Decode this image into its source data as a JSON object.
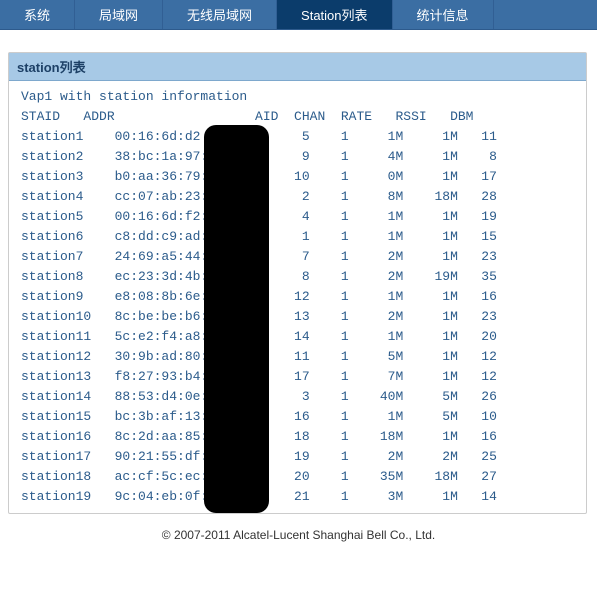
{
  "nav": {
    "items": [
      {
        "label": "系统",
        "active": false
      },
      {
        "label": "局域网",
        "active": false
      },
      {
        "label": "无线局域网",
        "active": false
      },
      {
        "label": "Station列表",
        "active": true
      },
      {
        "label": "统计信息",
        "active": false
      }
    ]
  },
  "panel": {
    "title": "station列表"
  },
  "term": {
    "header": "Vap1 with station information",
    "columns": "STAID   ADDR                  AID  CHAN  RATE   RSSI   DBM",
    "rows": [
      {
        "staid": "station1",
        "addr": "00:16:6d:d2",
        "aid": "5",
        "chan": "1",
        "rate": "1M",
        "rssi": "1M",
        "dbm": "11"
      },
      {
        "staid": "station2",
        "addr": "38:bc:1a:97:",
        "aid": "9",
        "chan": "1",
        "rate": "4M",
        "rssi": "1M",
        "dbm": "8"
      },
      {
        "staid": "station3",
        "addr": "b0:aa:36:79:",
        "aid": "10",
        "chan": "1",
        "rate": "0M",
        "rssi": "1M",
        "dbm": "17"
      },
      {
        "staid": "station4",
        "addr": "cc:07:ab:23:",
        "aid": "2",
        "chan": "1",
        "rate": "8M",
        "rssi": "18M",
        "dbm": "28"
      },
      {
        "staid": "station5",
        "addr": "00:16:6d:f2:",
        "aid": "4",
        "chan": "1",
        "rate": "1M",
        "rssi": "1M",
        "dbm": "19"
      },
      {
        "staid": "station6",
        "addr": "c8:dd:c9:ad:",
        "aid": "1",
        "chan": "1",
        "rate": "1M",
        "rssi": "1M",
        "dbm": "15"
      },
      {
        "staid": "station7",
        "addr": "24:69:a5:44:",
        "aid": "7",
        "chan": "1",
        "rate": "2M",
        "rssi": "1M",
        "dbm": "23"
      },
      {
        "staid": "station8",
        "addr": "ec:23:3d:4b:",
        "aid": "8",
        "chan": "1",
        "rate": "2M",
        "rssi": "19M",
        "dbm": "35"
      },
      {
        "staid": "station9",
        "addr": "e8:08:8b:6e:",
        "aid": "12",
        "chan": "1",
        "rate": "1M",
        "rssi": "1M",
        "dbm": "16"
      },
      {
        "staid": "station10",
        "addr": "8c:be:be:b6:",
        "aid": "13",
        "chan": "1",
        "rate": "2M",
        "rssi": "1M",
        "dbm": "23"
      },
      {
        "staid": "station11",
        "addr": "5c:e2:f4:a8:",
        "aid": "14",
        "chan": "1",
        "rate": "1M",
        "rssi": "1M",
        "dbm": "20"
      },
      {
        "staid": "station12",
        "addr": "30:9b:ad:80:",
        "aid": "11",
        "chan": "1",
        "rate": "5M",
        "rssi": "1M",
        "dbm": "12"
      },
      {
        "staid": "station13",
        "addr": "f8:27:93:b4:",
        "aid": "17",
        "chan": "1",
        "rate": "7M",
        "rssi": "1M",
        "dbm": "12"
      },
      {
        "staid": "station14",
        "addr": "88:53:d4:0e:",
        "aid": "3",
        "chan": "1",
        "rate": "40M",
        "rssi": "5M",
        "dbm": "26"
      },
      {
        "staid": "station15",
        "addr": "bc:3b:af:13:",
        "aid": "16",
        "chan": "1",
        "rate": "1M",
        "rssi": "5M",
        "dbm": "10"
      },
      {
        "staid": "station16",
        "addr": "8c:2d:aa:85:",
        "aid": "18",
        "chan": "1",
        "rate": "18M",
        "rssi": "1M",
        "dbm": "16"
      },
      {
        "staid": "station17",
        "addr": "90:21:55:df:",
        "aid": "19",
        "chan": "1",
        "rate": "2M",
        "rssi": "2M",
        "dbm": "25"
      },
      {
        "staid": "station18",
        "addr": "ac:cf:5c:ec:",
        "aid": "20",
        "chan": "1",
        "rate": "35M",
        "rssi": "18M",
        "dbm": "27"
      },
      {
        "staid": "station19",
        "addr": "9c:04:eb:0f:",
        "aid": "21",
        "chan": "1",
        "rate": "3M",
        "rssi": "1M",
        "dbm": "14"
      }
    ]
  },
  "footer": {
    "text": "© 2007-2011 Alcatel-Lucent Shanghai Bell Co., Ltd."
  }
}
